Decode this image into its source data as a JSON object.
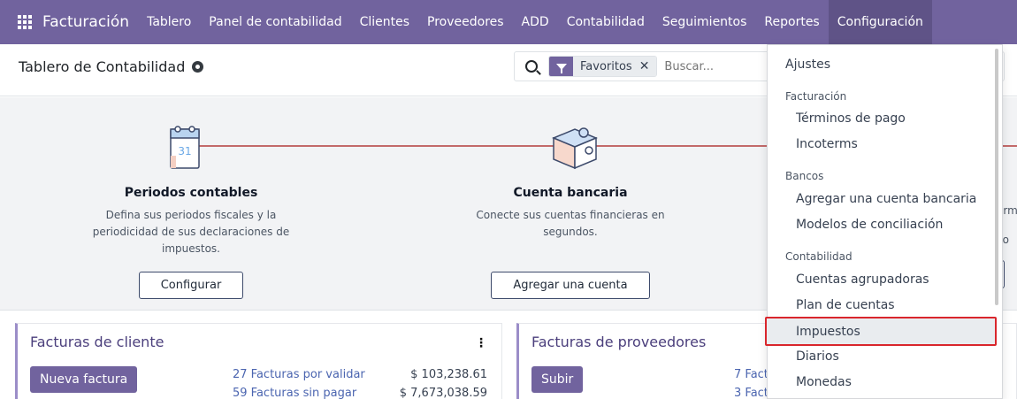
{
  "navbar": {
    "app_name": "Facturación",
    "menu": [
      "Tablero",
      "Panel de contabilidad",
      "Clientes",
      "Proveedores",
      "ADD",
      "Contabilidad",
      "Seguimientos",
      "Reportes",
      "Configuración"
    ],
    "active_menu": "Configuración",
    "color": "#71639e"
  },
  "control_panel": {
    "title": "Tablero de Contabilidad",
    "search": {
      "facet_label": "Favoritos",
      "placeholder": "Buscar..."
    }
  },
  "onboarding": {
    "steps": [
      {
        "title": "Periodos contables",
        "desc_lines": [
          "Defina sus periodos fiscales y la",
          "periodicidad de sus declaraciones de",
          "impuestos."
        ],
        "button": "Configurar",
        "icon": "calendar-icon",
        "icon_text": "31"
      },
      {
        "title": "Cuenta bancaria",
        "desc_lines": [
          "Conecte sus cuentas financieras en",
          "segundos."
        ],
        "button": "Agregar una cuenta",
        "icon": "puzzle-icon"
      }
    ],
    "cut_text": [
      "erm",
      "o co"
    ]
  },
  "cards": [
    {
      "title": "Facturas de cliente",
      "button": "Nueva factura",
      "rows": [
        {
          "label": "27 Facturas por validar",
          "amount": "$ 103,238.61"
        },
        {
          "label": "59 Facturas sin pagar",
          "amount": "$ 7,673,038.59"
        }
      ]
    },
    {
      "title": "Facturas de proveedores",
      "button": "Subir",
      "rows": [
        {
          "label": "7 Fact"
        },
        {
          "label": "3 Fact"
        }
      ]
    }
  ],
  "dropdown": {
    "items": [
      {
        "type": "item",
        "label": "Ajustes"
      },
      {
        "type": "header",
        "label": "Facturación"
      },
      {
        "type": "item",
        "label": "Términos de pago"
      },
      {
        "type": "item",
        "label": "Incoterms"
      },
      {
        "type": "header",
        "label": "Bancos"
      },
      {
        "type": "item",
        "label": "Agregar una cuenta bancaria"
      },
      {
        "type": "item",
        "label": "Modelos de conciliación"
      },
      {
        "type": "header",
        "label": "Contabilidad"
      },
      {
        "type": "item",
        "label": "Cuentas agrupadoras"
      },
      {
        "type": "item",
        "label": "Plan de cuentas"
      },
      {
        "type": "item",
        "label": "Impuestos",
        "selected": true
      },
      {
        "type": "item",
        "label": "Diarios"
      },
      {
        "type": "item",
        "label": "Monedas"
      }
    ]
  }
}
